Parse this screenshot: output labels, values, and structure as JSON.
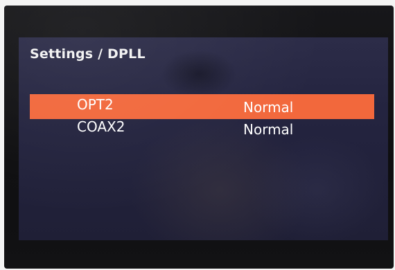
{
  "screen": {
    "breadcrumb": "Settings / DPLL"
  },
  "menu": {
    "items": [
      {
        "label": "OPT2",
        "value": "Normal",
        "selected": true
      },
      {
        "label": "COAX2",
        "value": "Normal",
        "selected": false
      }
    ]
  },
  "colors": {
    "selection_highlight": "#f2683c",
    "screen_background": "#262640",
    "text": "#ffffff"
  }
}
